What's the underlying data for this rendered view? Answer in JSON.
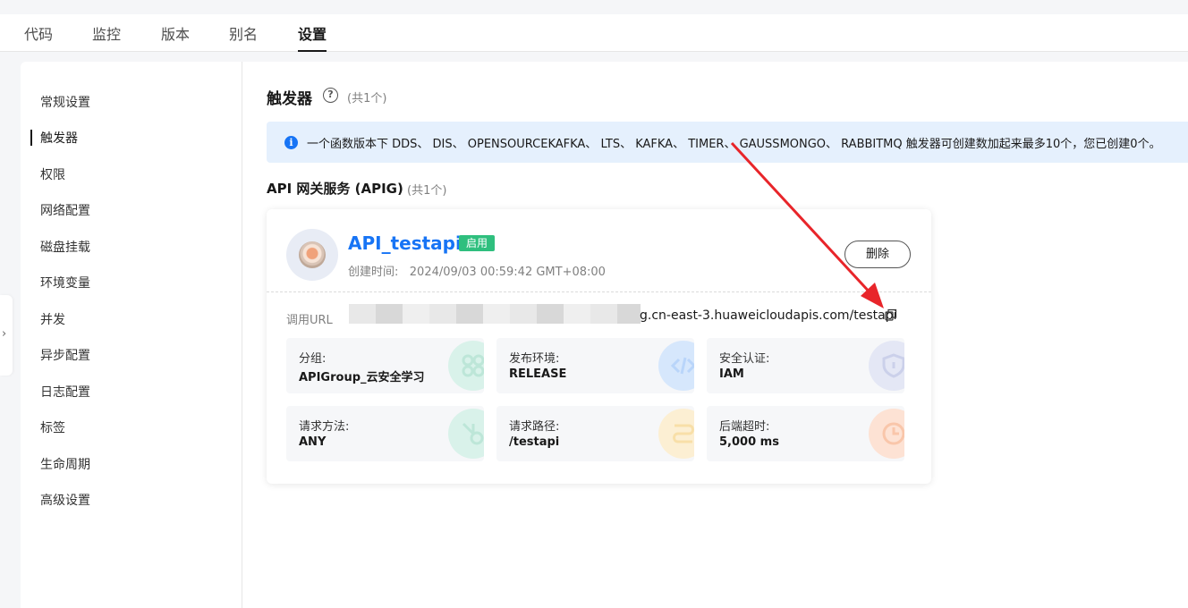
{
  "tabs": [
    {
      "label": "代码"
    },
    {
      "label": "监控"
    },
    {
      "label": "版本"
    },
    {
      "label": "别名"
    },
    {
      "label": "设置",
      "active": true
    }
  ],
  "sidebar": {
    "items": [
      {
        "label": "常规设置"
      },
      {
        "label": "触发器",
        "active": true
      },
      {
        "label": "权限"
      },
      {
        "label": "网络配置"
      },
      {
        "label": "磁盘挂载"
      },
      {
        "label": "环境变量"
      },
      {
        "label": "并发"
      },
      {
        "label": "异步配置"
      },
      {
        "label": "日志配置"
      },
      {
        "label": "标签"
      },
      {
        "label": "生命周期"
      },
      {
        "label": "高级设置"
      }
    ],
    "collapse_icon": "chevron-right-icon"
  },
  "section": {
    "title": "触发器",
    "count": "(共1个)",
    "help_icon": "question-circle-icon"
  },
  "alert": {
    "icon": "info-icon",
    "text": "一个函数版本下 DDS、 DIS、 OPENSOURCEKAFKA、 LTS、 KAFKA、 TIMER、 GAUSSMONGO、 RABBITMQ 触发器可创建数加起来最多10个，您已创建0个。"
  },
  "apig": {
    "title": "API 网关服务 (APIG)",
    "count": "(共1个)",
    "card": {
      "name": "API_testapi",
      "status": "启用",
      "created": "创建时间:   2024/09/03 00:59:42 GMT+08:00",
      "delete_label": "删除",
      "url_label": "调用URL",
      "url_visible": "g.cn-east-3.huaweicloudapis.com/testapi",
      "tiles": [
        {
          "label": "分组:",
          "value": "APIGroup_云安全学习",
          "icon": "group-icon",
          "color": "#26b58a"
        },
        {
          "label": "发布环境:",
          "value": "RELEASE",
          "icon": "code-icon",
          "color": "#2f86f6"
        },
        {
          "label": "安全认证:",
          "value": "IAM",
          "icon": "shield-icon",
          "color": "#7a86c8"
        },
        {
          "label": "请求方法:",
          "value": "ANY",
          "icon": "method-icon",
          "color": "#26b58a"
        },
        {
          "label": "请求路径:",
          "value": "/testapi",
          "icon": "path-icon",
          "color": "#f0b53a"
        },
        {
          "label": "后端超时:",
          "value": "5,000 ms",
          "icon": "clock-icon",
          "color": "#f08a4b"
        }
      ]
    }
  },
  "annotation": {
    "color": "#e8252a"
  }
}
